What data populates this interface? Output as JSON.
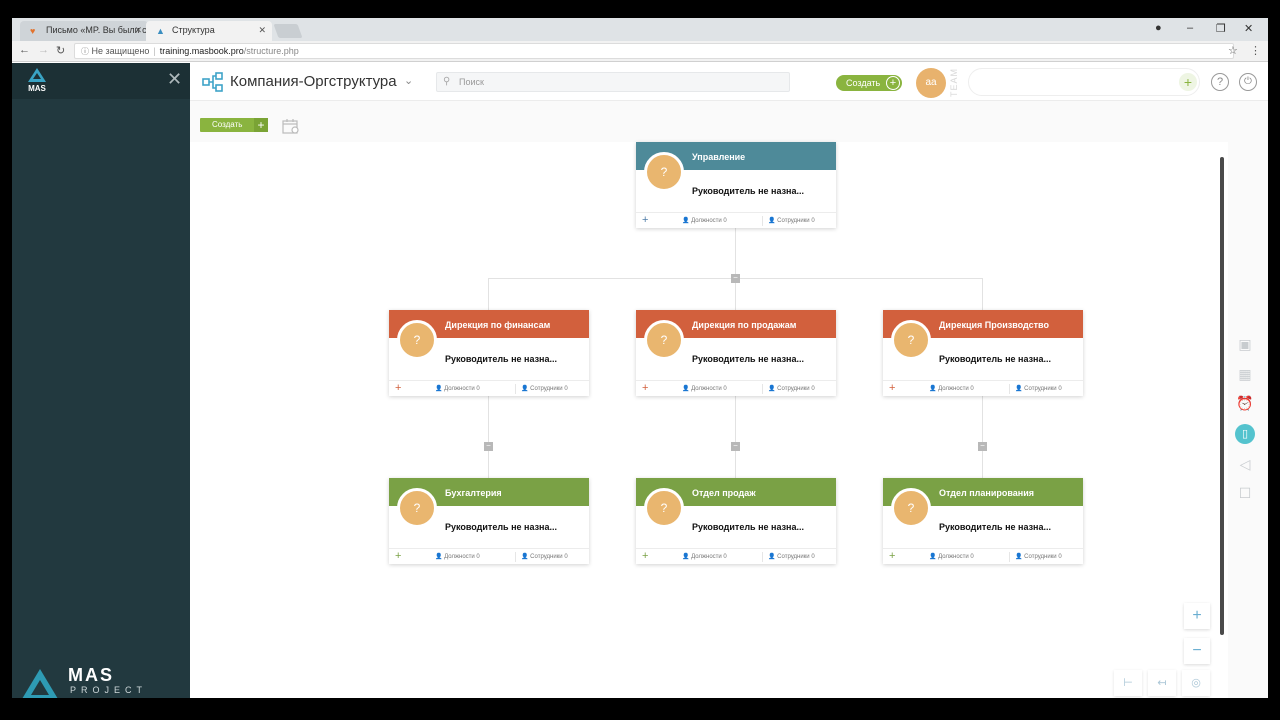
{
  "browser": {
    "tabs": [
      {
        "title": "Письмо «MP. Вы были с",
        "active": false
      },
      {
        "title": "Структура",
        "active": true
      }
    ],
    "security_label": "Не защищено",
    "url_host": "training.masbook.pro",
    "url_path": "/structure.php"
  },
  "sidebar": {
    "logo_small": "MAS",
    "logo_big": "MAS",
    "logo_sub": "PROJECT"
  },
  "topbar": {
    "title": "Компания-Оргструктура",
    "search_placeholder": "Поиск",
    "create_label": "Создать",
    "avatar_initials": "aa",
    "team_label": "TEAM"
  },
  "toolbar": {
    "create_label": "Создать"
  },
  "colors": {
    "teal": "#4e8a99",
    "red": "#d2603d",
    "green": "#7aa145",
    "accent_green": "#8ab43f",
    "avatar": "#e9b66f"
  },
  "orgchart": {
    "root": {
      "name": "Управление",
      "manager": "Руководитель не назна...",
      "positions": "Должности 0",
      "employees": "Сотрудники 0",
      "avatar": "?"
    },
    "directorates": [
      {
        "name": "Дирекция по финансам",
        "manager": "Руководитель не назна...",
        "positions": "Должности 0",
        "employees": "Сотрудники 0",
        "avatar": "?"
      },
      {
        "name": "Дирекция по продажам",
        "manager": "Руководитель не назна...",
        "positions": "Должности 0",
        "employees": "Сотрудники 0",
        "avatar": "?"
      },
      {
        "name": "Дирекция Производство",
        "manager": "Руководитель не назна...",
        "positions": "Должности 0",
        "employees": "Сотрудники 0",
        "avatar": "?"
      }
    ],
    "departments": [
      {
        "name": "Бухгалтерия",
        "manager": "Руководитель не назна...",
        "positions": "Должности 0",
        "employees": "Сотрудники 0",
        "avatar": "?"
      },
      {
        "name": "Отдел продаж",
        "manager": "Руководитель не назна...",
        "positions": "Должности 0",
        "employees": "Сотрудники 0",
        "avatar": "?"
      },
      {
        "name": "Отдел планирования",
        "manager": "Руководитель не назна...",
        "positions": "Должности 0",
        "employees": "Сотрудники 0",
        "avatar": "?"
      }
    ]
  },
  "right_icons": [
    "calendar-check-icon",
    "calendar-grid-icon",
    "alarm-clock-icon",
    "tablet-icon",
    "megaphone-icon",
    "chat-icon"
  ],
  "zoom": {
    "in": "+",
    "out": "−"
  }
}
